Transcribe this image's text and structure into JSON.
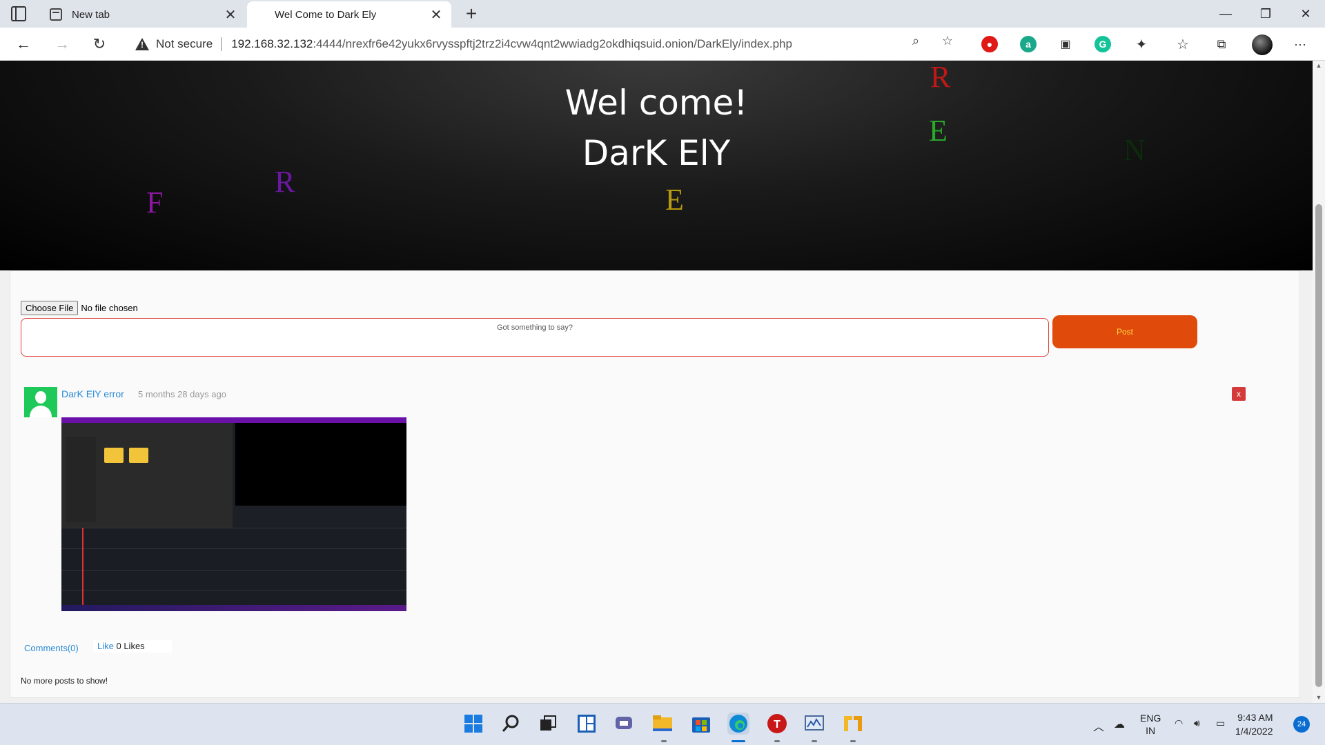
{
  "browser": {
    "tabs": [
      {
        "label": "New tab",
        "close": "✕"
      },
      {
        "label": "Wel Come to Dark Ely",
        "close": "✕"
      }
    ],
    "new_tab": "+",
    "window_controls": {
      "minimize": "—",
      "restore": "❐",
      "close": "✕"
    },
    "security_label": "Not secure",
    "url_host": "192.168.32.132",
    "url_rest": ":4444/nrexfr6e42yukx6rvysspftj2trz2i4cvw4qnt2wwiadg2okdhiqsuid.onion/DarkEly/index.php",
    "nav": {
      "back": "←",
      "forward": "→",
      "refresh": "↻"
    },
    "more": "···"
  },
  "hero": {
    "line1": "Wel come!",
    "line2": "DarK ElY",
    "letters": [
      "R",
      "E",
      "N",
      "R",
      "F",
      "E"
    ],
    "colors": {
      "R1": "#c01818",
      "E1": "#2aa82a",
      "N": "#0c2a0c",
      "R2": "#6a18a0",
      "F": "#8a18a0",
      "E2": "#b89a10"
    }
  },
  "composer": {
    "file_button": "Choose File",
    "file_status": "No file chosen",
    "placeholder": "Got something to say?",
    "post_button": "Post"
  },
  "post": {
    "author": "DarK ElY error",
    "time": "5 months 28 days ago",
    "delete": "x",
    "comments": "Comments(0)",
    "like": "Like",
    "likes": "0 Likes"
  },
  "footer_text": "No more posts to show!",
  "taskbar": {
    "icons": [
      "windows-start",
      "search",
      "task-view",
      "widgets",
      "teams-chat",
      "file-explorer",
      "store",
      "edge",
      "t-app",
      "monitor-app",
      "tool-app"
    ],
    "lang_top": "ENG",
    "lang_bottom": "IN",
    "time": "9:43 AM",
    "date": "1/4/2022",
    "notifications": "24"
  }
}
